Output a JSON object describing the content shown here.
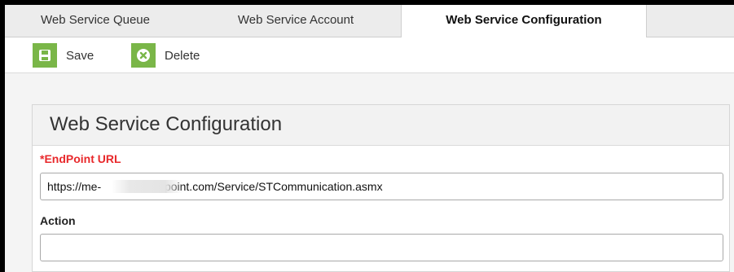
{
  "tabs": [
    {
      "label": "Web Service Queue",
      "active": false
    },
    {
      "label": "Web Service Account",
      "active": false
    },
    {
      "label": "Web Service Configuration",
      "active": true
    }
  ],
  "toolbar": {
    "save_label": "Save",
    "save_icon": "save-icon",
    "delete_label": "Delete",
    "delete_icon": "delete-x-icon",
    "icon_bg_color": "#7ab648"
  },
  "panel": {
    "title": "Web Service Configuration",
    "fields": {
      "endpoint_url": {
        "label": "*EndPoint URL",
        "value": "https://me-              edupoint.com/Service/STCommunication.asmx",
        "required": true,
        "label_color": "#e8282b"
      },
      "action": {
        "label": "Action",
        "value": ""
      }
    }
  }
}
